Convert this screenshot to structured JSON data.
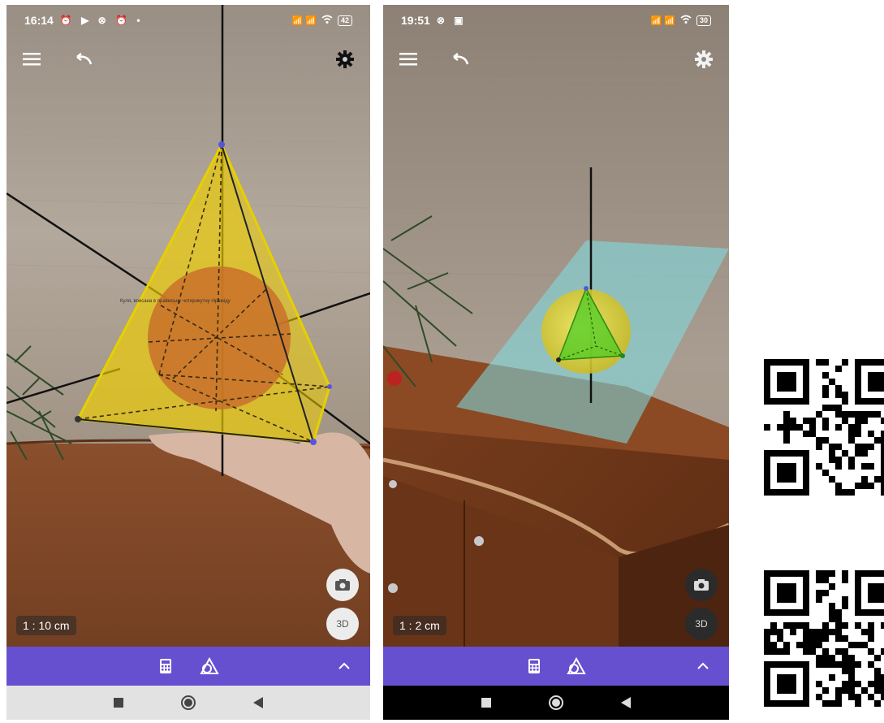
{
  "phones": [
    {
      "status_time": "16:14",
      "status_icons": "⏰ ▶ ⊗ ⏰ •",
      "signal": "📶 📶",
      "battery": "42",
      "overlay_label": "Куля, вписана в правильну чотирикутну піраміду",
      "scale": "1 : 10 cm",
      "fab_3d": "3D"
    },
    {
      "status_time": "19:51",
      "status_icons": "⊗ ▣",
      "signal": "📶 📶",
      "battery": "30",
      "scale": "1 : 2 cm",
      "fab_3d": "3D"
    }
  ],
  "colors": {
    "toolbar": "#6750d0",
    "pyramid_fill": "#f0d000",
    "sphere_orange": "#c9702a",
    "plane_cyan": "#7fe0e8",
    "tetra_green": "#44cc22"
  },
  "icons": [
    "menu-icon",
    "undo-icon",
    "gear-icon",
    "camera-icon",
    "calculator-icon",
    "geometry-tools-icon",
    "chevron-up-icon",
    "nav-square-icon",
    "nav-home-icon",
    "nav-back-icon"
  ]
}
